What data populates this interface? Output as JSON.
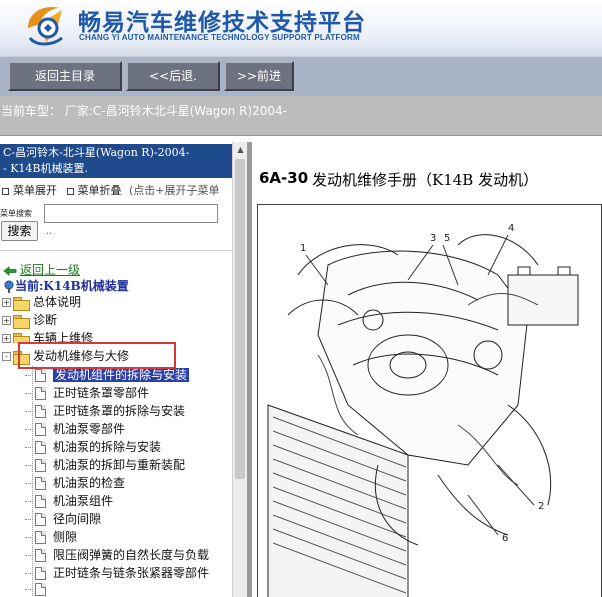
{
  "header": {
    "title": "畅易汽车维修技术支持平台",
    "subtitle": "CHANG YI AUTO MAINTENANCE TECHNOLOGY SUPPORT PLATFORM"
  },
  "toolbar": {
    "home": "返回主目录",
    "back": "<<后退.",
    "forward": ">>前进"
  },
  "vehicle": {
    "label": "当前车型：  厂家:C-昌河铃木北斗星(Wagon R)2004-"
  },
  "sidebar": {
    "model_line1": "C-昌河铃木-北斗星(Wagon R)-2004-",
    "model_line2": "- K14B机械装置.",
    "expand": "菜单展开",
    "collapse": "菜单折叠",
    "hint": "(点击+展开子菜单",
    "search_label": "菜单搜索",
    "search_value": "",
    "search_button": "搜索",
    "dots": "..",
    "back_up": "返回上一级",
    "current": "当前:K14B机械装置",
    "folders": [
      {
        "label": "总体说明",
        "state": "+"
      },
      {
        "label": "诊断",
        "state": "+"
      },
      {
        "label": "车辆上维修",
        "state": "+"
      },
      {
        "label": "发动机维修与大修",
        "state": "-"
      }
    ],
    "items": [
      "发动机组件的拆除与安装",
      "正时链条罩零部件",
      "正时链条罩的拆除与安装",
      "机油泵零部件",
      "机油泵的拆除与安装",
      "机油泵的拆卸与重新装配",
      "机油泵的检查",
      "机油泵组件",
      "径向间隙",
      "侧隙",
      "限压阀弹簧的自然长度与负载",
      "正时链条与链条张紧器零部件",
      ""
    ],
    "selected_index": 0
  },
  "document": {
    "page_number": "6A-30",
    "page_title": "发动机维修手册（K14B 发动机）",
    "callouts": [
      "1",
      "2",
      "3",
      "4",
      "5",
      "6"
    ]
  },
  "colors": {
    "brand_blue": "#1f58a8",
    "model_header_bg": "#1f4b8c",
    "highlight_box": "#d43a3a",
    "selected_bg": "#2b3fa8",
    "link_green": "#1a7a1a"
  }
}
